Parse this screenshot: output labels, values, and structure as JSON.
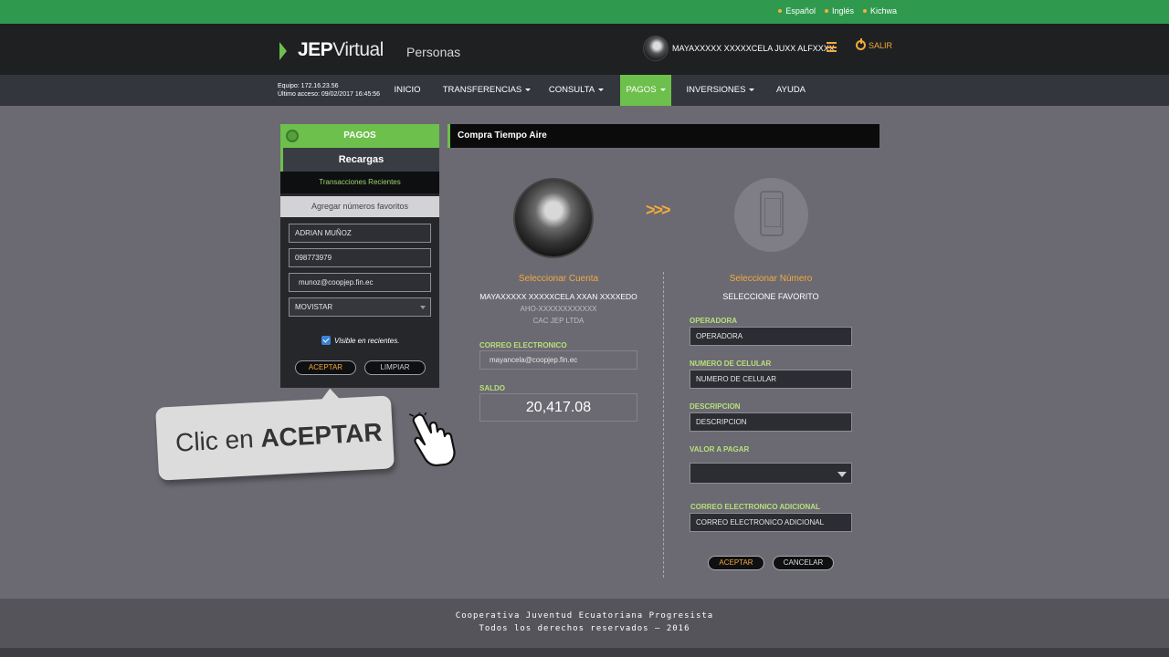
{
  "languages": [
    "Español",
    "Inglés",
    "Kichwa"
  ],
  "header": {
    "logo_bold": "JEP",
    "logo_thin": "Virtual",
    "section": "Personas",
    "username": "MAYAXXXXX XXXXXCELA JUXX ALFXXXX",
    "logout_label": "SALIR"
  },
  "nav": {
    "equipo": "Equipo: 172.16.23.56",
    "ultimo_acceso": "Último acceso: 09/02/2017 16:45:56",
    "items": [
      {
        "label": "INICIO",
        "dropdown": false
      },
      {
        "label": "TRANSFERENCIAS",
        "dropdown": true
      },
      {
        "label": "CONSULTA",
        "dropdown": true
      },
      {
        "label": "PAGOS",
        "dropdown": true,
        "active": true
      },
      {
        "label": "INVERSIONES",
        "dropdown": true
      },
      {
        "label": "AYUDA",
        "dropdown": false
      }
    ]
  },
  "left_panel": {
    "title": "PAGOS",
    "subtitle": "Recargas",
    "recent_link": "Transacciones Recientes",
    "add_favorites": "Agregar números favoritos",
    "fields": {
      "name": "ADRIAN MUÑOZ",
      "phone": "098773979",
      "email": "munoz@coopjep.fin.ec",
      "operator": "MOVISTAR"
    },
    "checkbox_label": "Visible en recientes.",
    "checkbox_checked": true,
    "accept_label": "ACEPTAR",
    "clear_label": "LIMPIAR"
  },
  "callout": {
    "prefix": "Clic en ",
    "emphasis": "ACEPTAR"
  },
  "main": {
    "title": "Compra Tiempo Aire",
    "arrows": ">>>",
    "account": {
      "heading": "Seleccionar Cuenta",
      "holder": "MAYAXXXXX XXXXXCELA XXAN XXXXEDO",
      "account_number": "AHO-XXXXXXXXXXXX",
      "institution": "CAC JEP LTDA",
      "email_label": "CORREO ELECTRONICO",
      "email_value": "mayancela@coopjep.fin.ec",
      "balance_label": "SALDO",
      "balance_value": "20,417.08"
    },
    "number": {
      "heading": "Seleccionar Número",
      "favorite_label": "SELECCIONE FAVORITO",
      "operator_label": "OPERADORA",
      "operator_placeholder": "OPERADORA",
      "cell_label": "NUMERO DE CELULAR",
      "cell_placeholder": "NUMERO DE CELULAR",
      "desc_label": "DESCRIPCION",
      "desc_placeholder": "DESCRIPCION",
      "amount_label": "VALOR A PAGAR",
      "amount_value": "",
      "extra_email_label": "CORREO ELECTRONICO ADICIONAL",
      "extra_email_placeholder": "CORREO ELECTRONICO ADICIONAL"
    },
    "accept_label": "ACEPTAR",
    "cancel_label": "CANCELAR"
  },
  "footer": {
    "line1": "Cooperativa Juventud Ecuatoriana Progresista",
    "line2": "Todos los derechos reservados – 2016"
  },
  "colors": {
    "brand_green": "#6dc04b",
    "top_green": "#2f9a4e",
    "accent_orange": "#f4a93b"
  }
}
